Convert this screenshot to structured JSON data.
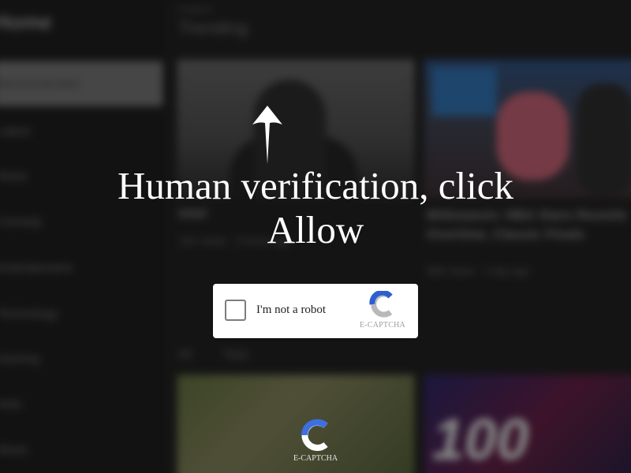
{
  "background": {
    "brand": "Home",
    "nav_items": [
      "Recommended",
      "Latest",
      "News",
      "Comedy",
      "Entertainment",
      "Technology",
      "Gaming",
      "Auto",
      "Music"
    ],
    "header": {
      "subtitle": "Explore",
      "title": "Trending"
    },
    "cards": [
      {
        "title": "Intel",
        "meta": "12K views · 2 hours ago"
      },
      {
        "title": "Midseason: NBA Stars Reunite Overtime, Classic Finals",
        "meta": "48K views · 1 day ago"
      }
    ],
    "tabs": [
      "All",
      "Topic"
    ],
    "promo_text": "100"
  },
  "overlay": {
    "headline": "Human verification, click Allow",
    "arrow_icon": "up-arrow-icon"
  },
  "captcha": {
    "checkbox_label": "I'm not a robot",
    "brand_caption": "E-CAPTCHA",
    "logo_colors": {
      "blue": "#2d5fd3",
      "gray": "#b9b9b9"
    }
  },
  "footer": {
    "brand_caption": "E-CAPTCHA"
  }
}
